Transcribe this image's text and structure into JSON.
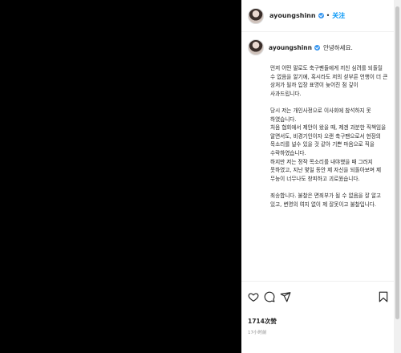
{
  "header": {
    "username": "ayoungshinn",
    "separator": "•",
    "follow_label": "关注"
  },
  "caption": {
    "username": "ayoungshinn",
    "greeting": "안녕하세요.",
    "paragraphs": [
      "먼저 어떤 말로도 축구팬들에게 끼친 심려를 되돌릴 수 없음을 알기에, 혹시라도 저의 섣부른 언행이 더 큰 상처가 될까 입장 표명이 늦어진 점 깊이 사과드립니다.",
      "당시 저는 개인사정으로 이사회에 참석하지 못 하였습니다.\n처음 협회에서 제안이 왔을 때, 제겐 과분한 직책임을 알면서도, 비경기인이자 오랜 축구팬으로서 현장의 목소리를 널수 있을 것 같아 기쁜 마음으로 직을 수락하였습니다.\n하지만 저는 정작 목소리를 내야했을 때 그러지 못하였고, 지난 몇일 동안 제 자신을 되돌아보며 제 무능이 너무나도 창피하고 괴로웠습니다.",
      "죄송합니다. 불찰은 면죄부가 될 수 없음을 잘 알고 있고, 변명의 여지 없이 제 잘못이고 불찰입니다."
    ]
  },
  "actions": {
    "likes": "1714次赞",
    "time": "17小时前"
  }
}
